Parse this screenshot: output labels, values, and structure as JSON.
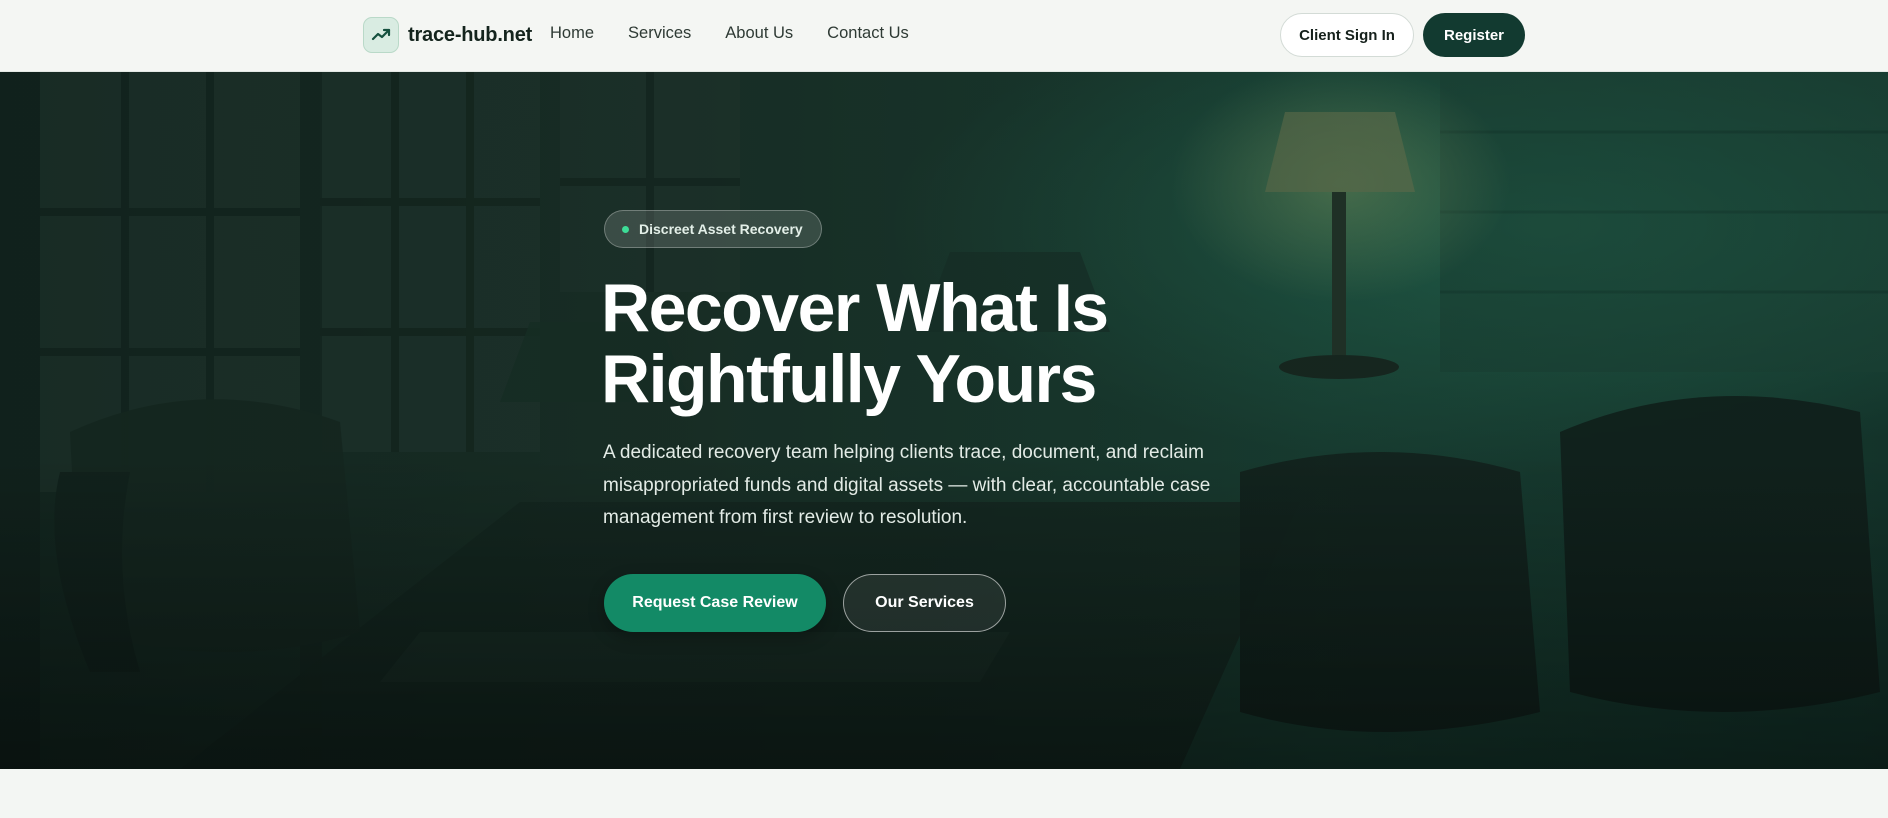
{
  "header": {
    "brand_name": "trace-hub.net",
    "logo_icon": "trending-up-icon",
    "nav": [
      {
        "label": "Home"
      },
      {
        "label": "Services"
      },
      {
        "label": "About Us"
      },
      {
        "label": "Contact Us"
      }
    ],
    "signin_label": "Client Sign In",
    "register_label": "Register"
  },
  "hero": {
    "badge_label": "Discreet Asset Recovery",
    "headline_line1": "Recover What Is",
    "headline_line2": "Rightfully Yours",
    "description": "A dedicated recovery team helping clients trace, document, and reclaim misappropriated funds and digital assets — with clear, accountable case management from first review to resolution.",
    "primary_cta": "Request Case Review",
    "secondary_cta": "Our Services",
    "background_image": "dimly-lit-office-with-leather-chairs-and-desk-lamps"
  },
  "colors": {
    "accent": "#138a66",
    "dark_green": "#123a30",
    "badge_dot": "#3ddc97",
    "page_bg": "#f3f6f3"
  }
}
